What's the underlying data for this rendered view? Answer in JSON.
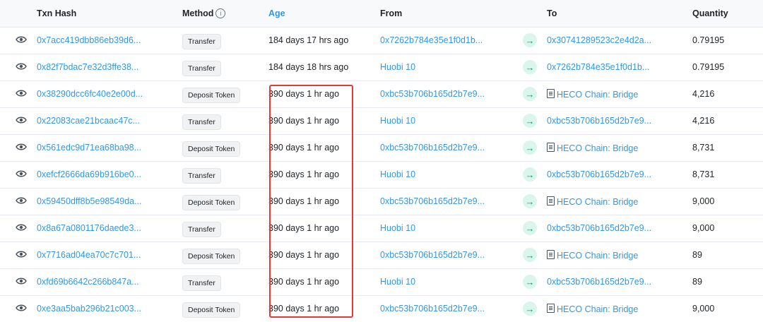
{
  "headers": {
    "txn_hash": "Txn Hash",
    "method": "Method",
    "age": "Age",
    "from": "From",
    "to": "To",
    "quantity": "Quantity"
  },
  "colors": {
    "link": "#3498db",
    "highlight": "#e53935",
    "arrow_bg": "#d9f5ec",
    "arrow_fg": "#00a186"
  },
  "icons": {
    "view": "eye-icon",
    "direction": "arrow-right-icon",
    "contract": "document-icon",
    "info": "info-icon"
  },
  "rows": [
    {
      "hash": "0x7acc419dbb86eb39d6...",
      "method": "Transfer",
      "age": "184 days 17 hrs ago",
      "from": "0x7262b784e35e1f0d1b...",
      "from_is_link": true,
      "to": "0x30741289523c2e4d2a...",
      "to_contract": false,
      "qty": "0.79195"
    },
    {
      "hash": "0x82f7bdac7e32d3ffe38...",
      "method": "Transfer",
      "age": "184 days 18 hrs ago",
      "from": "Huobi 10",
      "from_is_link": true,
      "to": "0x7262b784e35e1f0d1b...",
      "to_contract": false,
      "qty": "0.79195"
    },
    {
      "hash": "0x38290dcc6fc40e2e00d...",
      "method": "Deposit Token",
      "age": "390 days 1 hr ago",
      "from": "0xbc53b706b165d2b7e9...",
      "from_is_link": true,
      "to": "HECO Chain: Bridge",
      "to_contract": true,
      "qty": "4,216"
    },
    {
      "hash": "0x22083cae21bcaac47c...",
      "method": "Transfer",
      "age": "390 days 1 hr ago",
      "from": "Huobi 10",
      "from_is_link": true,
      "to": "0xbc53b706b165d2b7e9...",
      "to_contract": false,
      "qty": "4,216"
    },
    {
      "hash": "0x561edc9d71ea68ba98...",
      "method": "Deposit Token",
      "age": "390 days 1 hr ago",
      "from": "0xbc53b706b165d2b7e9...",
      "from_is_link": true,
      "to": "HECO Chain: Bridge",
      "to_contract": true,
      "qty": "8,731"
    },
    {
      "hash": "0xefcf2666da69b916be0...",
      "method": "Transfer",
      "age": "390 days 1 hr ago",
      "from": "Huobi 10",
      "from_is_link": true,
      "to": "0xbc53b706b165d2b7e9...",
      "to_contract": false,
      "qty": "8,731"
    },
    {
      "hash": "0x59450dff8b5e98549da...",
      "method": "Deposit Token",
      "age": "390 days 1 hr ago",
      "from": "0xbc53b706b165d2b7e9...",
      "from_is_link": true,
      "to": "HECO Chain: Bridge",
      "to_contract": true,
      "qty": "9,000"
    },
    {
      "hash": "0x8a67a0801176daede3...",
      "method": "Transfer",
      "age": "390 days 1 hr ago",
      "from": "Huobi 10",
      "from_is_link": true,
      "to": "0xbc53b706b165d2b7e9...",
      "to_contract": false,
      "qty": "9,000"
    },
    {
      "hash": "0x7716ad04ea70c7c701...",
      "method": "Deposit Token",
      "age": "390 days 1 hr ago",
      "from": "0xbc53b706b165d2b7e9...",
      "from_is_link": true,
      "to": "HECO Chain: Bridge",
      "to_contract": true,
      "qty": "89"
    },
    {
      "hash": "0xfd69b6642c266b847a...",
      "method": "Transfer",
      "age": "390 days 1 hr ago",
      "from": "Huobi 10",
      "from_is_link": true,
      "to": "0xbc53b706b165d2b7e9...",
      "to_contract": false,
      "qty": "89"
    },
    {
      "hash": "0xe3aa5bab296b21c003...",
      "method": "Deposit Token",
      "age": "390 days 1 hr ago",
      "from": "0xbc53b706b165d2b7e9...",
      "from_is_link": true,
      "to": "HECO Chain: Bridge",
      "to_contract": true,
      "qty": "9,000"
    }
  ]
}
